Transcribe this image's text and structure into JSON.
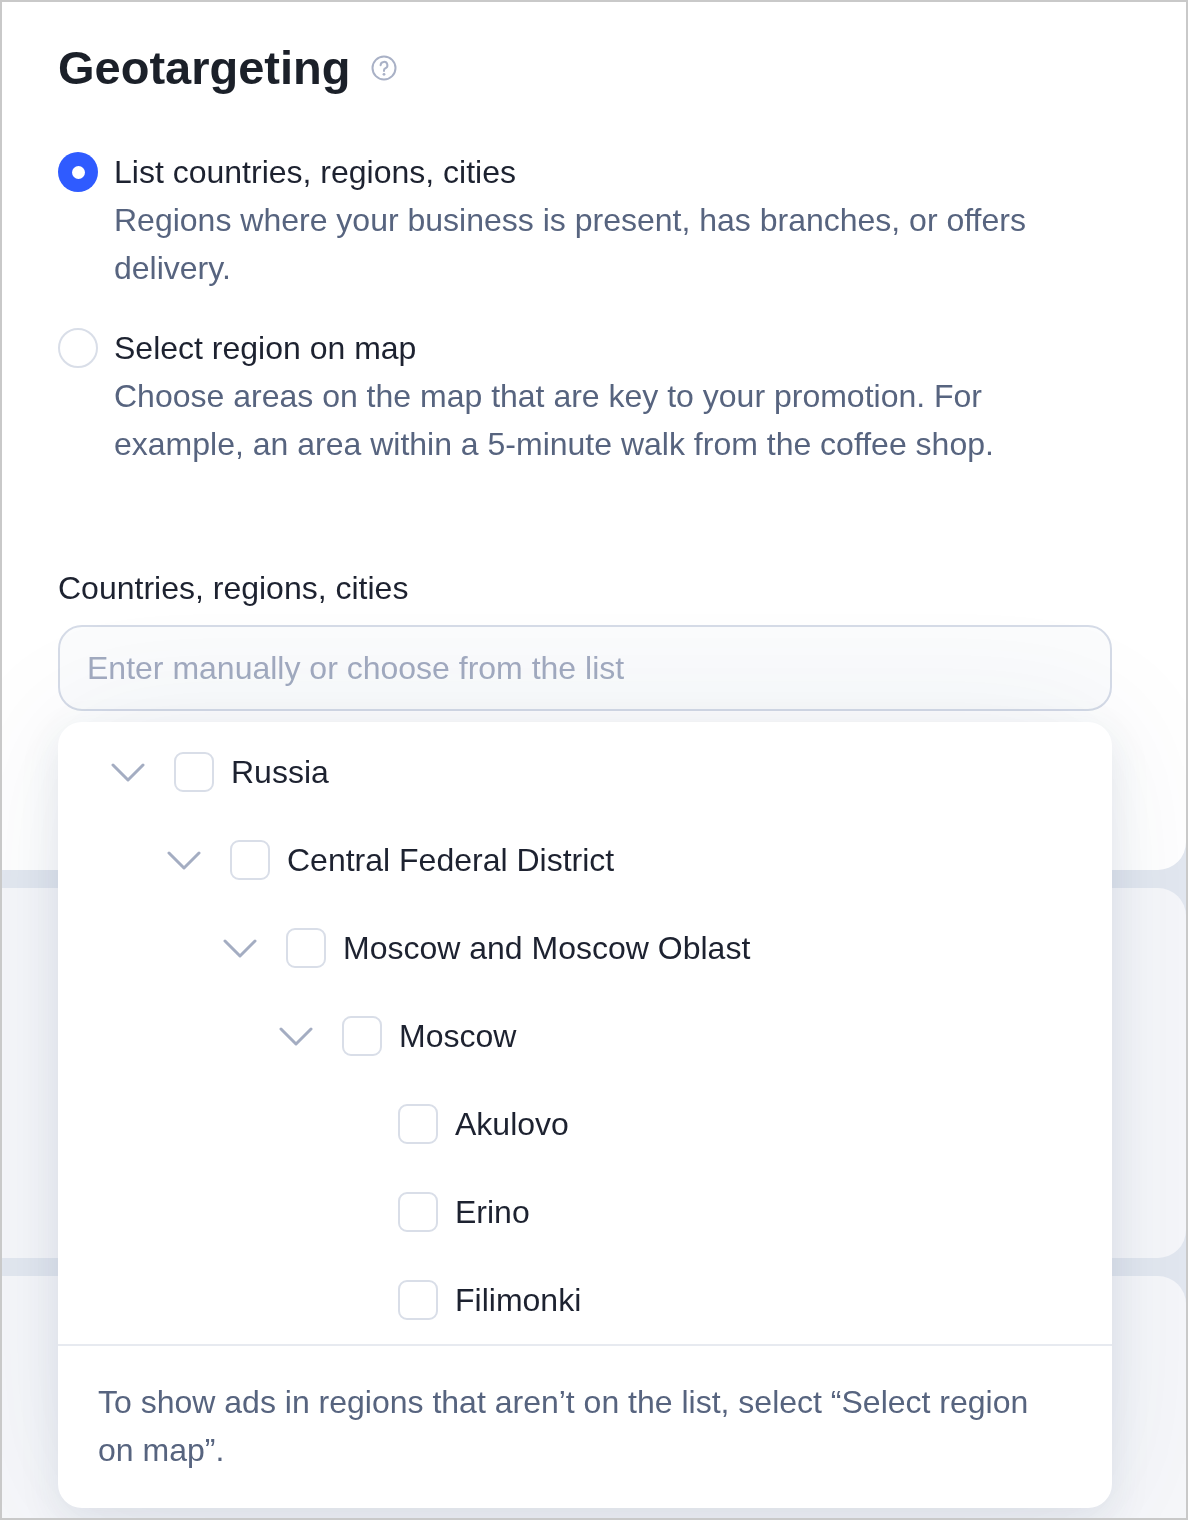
{
  "title": "Geotargeting",
  "targeting_options": [
    {
      "label": "List countries, regions, cities",
      "description": "Regions where your business is present, has branches, or offers delivery.",
      "selected": true
    },
    {
      "label": "Select region on map",
      "description": "Choose areas on the map that are key to your promotion. For example, an area within a 5-minute walk from the coffee shop.",
      "selected": false
    }
  ],
  "region_field": {
    "label": "Countries, regions, cities",
    "placeholder": "Enter manually or choose from the list"
  },
  "region_dropdown": {
    "tree": [
      {
        "label": "Russia",
        "checked": false,
        "expanded": true,
        "children": [
          {
            "label": "Central Federal District",
            "checked": false,
            "expanded": true,
            "children": [
              {
                "label": "Moscow and Moscow Oblast",
                "checked": false,
                "expanded": true,
                "children": [
                  {
                    "label": "Moscow",
                    "checked": false,
                    "expanded": true,
                    "children": [
                      {
                        "label": "Akulovo",
                        "checked": false
                      },
                      {
                        "label": "Erino",
                        "checked": false
                      },
                      {
                        "label": "Filimonki",
                        "checked": false
                      }
                    ]
                  }
                ]
              }
            ]
          }
        ]
      }
    ],
    "note": "To show ads in regions that aren’t on the list, select “Select region on map”."
  }
}
